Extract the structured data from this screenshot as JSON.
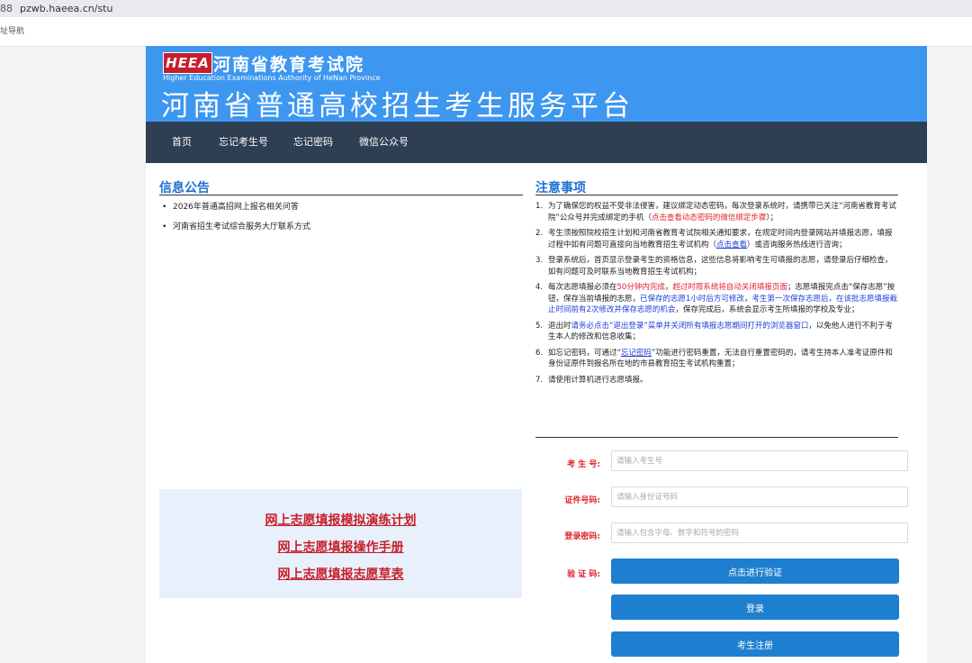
{
  "browser": {
    "url": "pzwb.haeea.cn/stu",
    "bookmark_label": "址导航",
    "grid_glyph": "88"
  },
  "header": {
    "logo_text": "HEEA",
    "institution_cn": "河南省教育考试院",
    "institution_en": "Higher Education Examinations Authority of HeNan Province",
    "platform_title": "河南省普通高校招生考生服务平台"
  },
  "nav": {
    "items": [
      "首页",
      "忘记考生号",
      "忘记密码",
      "微信公众号"
    ]
  },
  "announcements": {
    "title": "信息公告",
    "items": [
      "2026年普通高招网上报名相关问答",
      "河南省招生考试综合服务大厅联系方式"
    ]
  },
  "notes": {
    "title": "注意事项",
    "items": [
      {
        "num": "1.",
        "parts": [
          {
            "t": "为了确保您的权益不受非法侵害，建议绑定动态密码，每次登录系统时，请携带已关注“河南省教育考试院”公众号并完成绑定的手机（"
          },
          {
            "t": "点击查看动态密码的微信绑定步骤",
            "s": "red"
          },
          {
            "t": "）；"
          }
        ]
      },
      {
        "num": "2.",
        "parts": [
          {
            "t": "考生须按照院校招生计划和河南省教育考试院相关通知要求，在规定时间内登录网站并填报志愿，填报过程中如有问题可直接向当地教育招生考试机构（"
          },
          {
            "t": "点击查看",
            "s": "link"
          },
          {
            "t": "）或咨询服务热线进行咨询；"
          }
        ]
      },
      {
        "num": "3.",
        "parts": [
          {
            "t": "登录系统后，首页显示登录考生的资格信息，这些信息将影响考生可填报的志愿，请登录后仔细检查，如有问题可及时联系当地教育招生考试机构；"
          }
        ]
      },
      {
        "num": "4.",
        "parts": [
          {
            "t": "每次志愿填报必须在"
          },
          {
            "t": "50分钟内完成",
            "s": "red"
          },
          {
            "t": "，"
          },
          {
            "t": "超过时限系统将自动关闭填报页面",
            "s": "red"
          },
          {
            "t": "；志愿填报完点击“保存志愿”按钮，保存当前填报的志愿，"
          },
          {
            "t": "已保存的志愿1小时后方可修改",
            "s": "blue"
          },
          {
            "t": "，"
          },
          {
            "t": "考生第一次保存志愿后，在该批志愿填报截止时间前有2次修改并保存志愿的机会",
            "s": "blue"
          },
          {
            "t": "，保存完成后，系统会显示考生所填报的学校及专业；"
          }
        ]
      },
      {
        "num": "5.",
        "parts": [
          {
            "t": "退出时"
          },
          {
            "t": "请务必点击“退出登录”菜单并关闭所有填报志愿期间打开的浏览器窗口",
            "s": "blue"
          },
          {
            "t": "，以免他人进行不利于考生本人的修改和信息收集；"
          }
        ]
      },
      {
        "num": "6.",
        "parts": [
          {
            "t": "如忘记密码，可通过“"
          },
          {
            "t": "忘记密码",
            "s": "link"
          },
          {
            "t": "”功能进行密码重置，无法自行重置密码的，请考生持本人准考证原件和身份证原件到报名所在地的市县教育招生考试机构重置；"
          }
        ]
      },
      {
        "num": "7.",
        "parts": [
          {
            "t": "请使用计算机进行志愿填报。"
          }
        ]
      }
    ]
  },
  "links": {
    "items": [
      "网上志愿填报模拟演练计划",
      "网上志愿填报操作手册",
      "网上志愿填报志愿草表"
    ]
  },
  "login": {
    "exam_no_label": "考 生 号:",
    "exam_no_placeholder": "请输入考生号",
    "id_label": "证件号码:",
    "id_placeholder": "请输入身份证号码",
    "password_label": "登录密码:",
    "password_placeholder": "请输入包含字母、数字和符号的密码",
    "captcha_label": "验 证 码:",
    "captcha_button": "点击进行验证",
    "login_button": "登录",
    "register_button": "考生注册"
  },
  "colors": {
    "banner_blue": "#3d97f0",
    "nav_dark": "#2e3e53",
    "button_blue": "#1e7fd0",
    "accent_red": "#e0232b",
    "title_blue": "#1e6fd0"
  }
}
